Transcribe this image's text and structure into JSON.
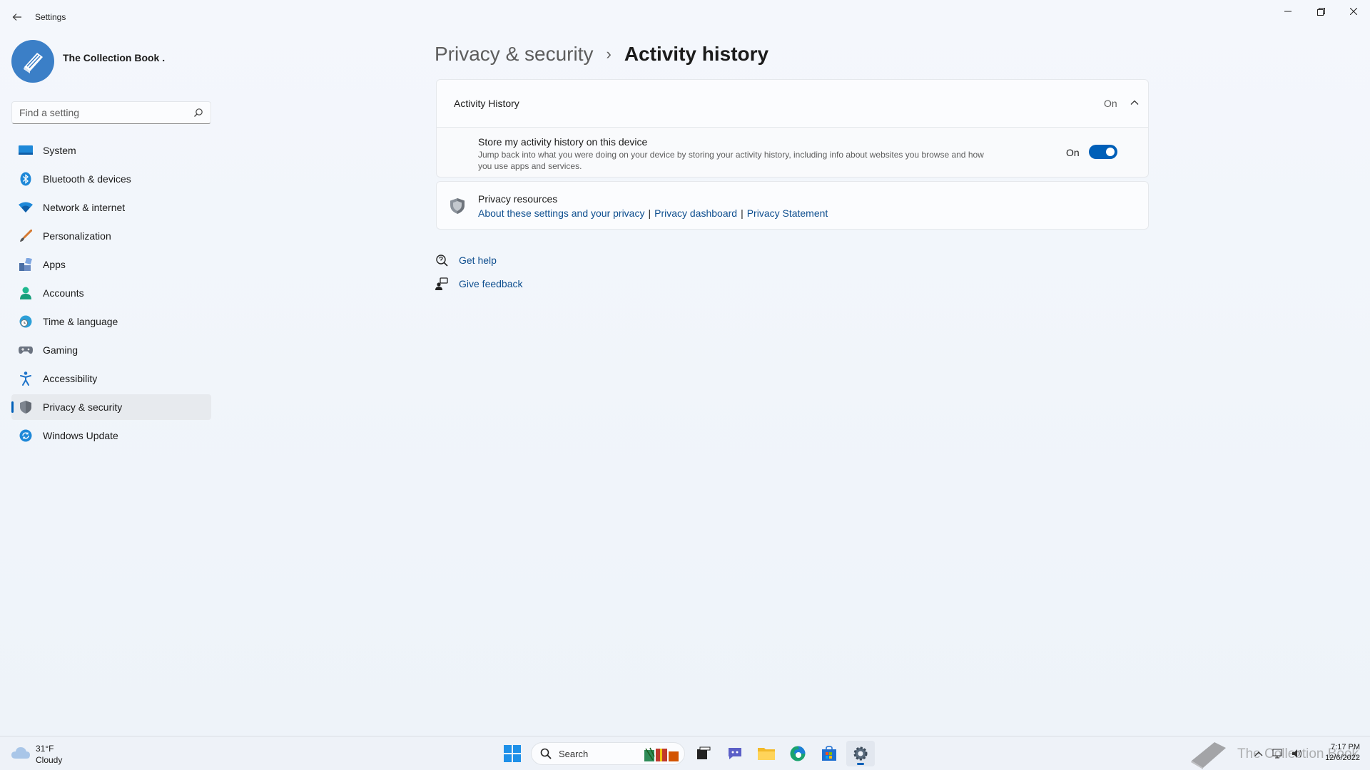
{
  "window": {
    "app_title": "Settings",
    "controls": {
      "minimize": "—",
      "maximize": "❐",
      "close": "✕"
    }
  },
  "profile": {
    "name": "The Collection Book ."
  },
  "search": {
    "placeholder": "Find a setting"
  },
  "sidebar": {
    "items": [
      {
        "label": "System",
        "icon": "system-icon"
      },
      {
        "label": "Bluetooth & devices",
        "icon": "bluetooth-icon"
      },
      {
        "label": "Network & internet",
        "icon": "wifi-icon"
      },
      {
        "label": "Personalization",
        "icon": "brush-icon"
      },
      {
        "label": "Apps",
        "icon": "apps-icon"
      },
      {
        "label": "Accounts",
        "icon": "account-icon"
      },
      {
        "label": "Time & language",
        "icon": "globe-clock-icon"
      },
      {
        "label": "Gaming",
        "icon": "gamepad-icon"
      },
      {
        "label": "Accessibility",
        "icon": "accessibility-icon"
      },
      {
        "label": "Privacy & security",
        "icon": "shield-icon",
        "active": true
      },
      {
        "label": "Windows Update",
        "icon": "update-icon"
      }
    ]
  },
  "breadcrumb": {
    "parent": "Privacy & security",
    "separator": "›",
    "current": "Activity history"
  },
  "activity_history": {
    "title": "Activity History",
    "state": "On",
    "store": {
      "title": "Store my activity history on this device",
      "description": "Jump back into what you were doing on your device by storing your activity history, including info about websites you browse and how you use apps and services.",
      "toggle_label": "On",
      "toggle_on": true
    }
  },
  "privacy_resources": {
    "title": "Privacy resources",
    "links": [
      "About these settings and your privacy",
      "Privacy dashboard",
      "Privacy Statement"
    ],
    "separator": "|"
  },
  "help": {
    "get_help": "Get help",
    "give_feedback": "Give feedback"
  },
  "taskbar": {
    "weather": {
      "temp": "31°F",
      "condition": "Cloudy"
    },
    "search_label": "Search",
    "watermark": "The Collection Book",
    "clock": {
      "time": "7:17 PM",
      "date": "12/6/2022"
    }
  },
  "colors": {
    "accent": "#005fb8",
    "link": "#0f4f8f",
    "background": "#f3f6fb"
  }
}
